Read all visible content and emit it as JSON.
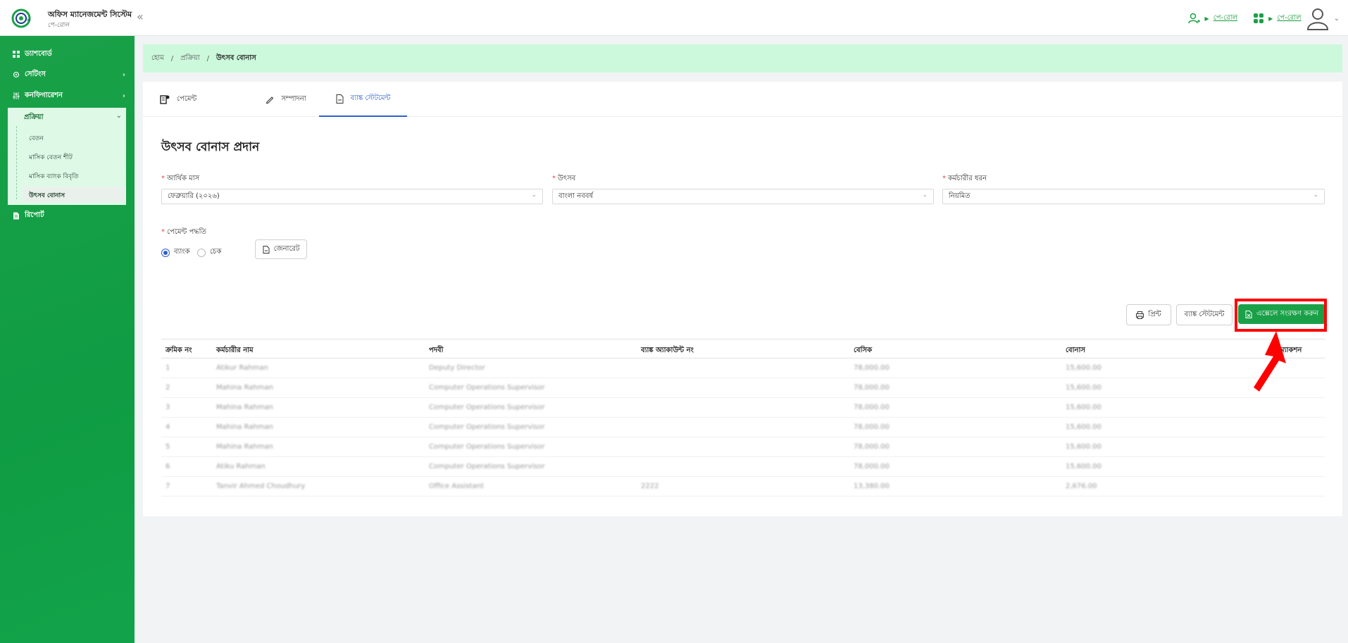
{
  "header": {
    "app_title": "অফিস ম্যানেজমেন্ট সিস্টেম",
    "app_subtitle": "পে-রোল",
    "collapse_icon": "double-chevron-left",
    "module_link_1": "পে-রোল",
    "module_link_2": "পে-রোল"
  },
  "sidebar": {
    "items": [
      {
        "label": "ড্যাশবোর্ড",
        "icon": "grid-icon"
      },
      {
        "label": "সেটিংস",
        "icon": "gear-icon"
      },
      {
        "label": "কনফিগারেশন",
        "icon": "sliders-icon"
      },
      {
        "label": "প্রক্রিয়া",
        "icon": "process-icon"
      },
      {
        "label": "রিপোর্ট",
        "icon": "document-icon"
      }
    ],
    "submenu": [
      {
        "label": "বেতন"
      },
      {
        "label": "মাসিক বেতন শীট"
      },
      {
        "label": "মাসিক ব্যাংক বিবৃতি"
      },
      {
        "label": "উৎসব বোনাস"
      }
    ]
  },
  "breadcrumb": {
    "home": "হোম",
    "sep": "/",
    "section": "প্রক্রিয়া",
    "current": "উৎসব বোনাস"
  },
  "tabs": [
    {
      "label": "পেমেন্ট",
      "active": false
    },
    {
      "label": "সম্পাদনা",
      "active": false
    },
    {
      "label": "ব্যাঙ্ক স্টেটমেন্ট",
      "active": true
    }
  ],
  "page_title": "উৎসব বোনাস প্রদান",
  "form": {
    "month_label": "আর্থিক মাস",
    "month_value": "ফেব্রুয়ারি (২০২৬)",
    "festival_label": "উৎসব",
    "festival_value": "বাংলা নববর্ষ",
    "emp_type_label": "কর্মচারীর ধরন",
    "emp_type_value": "নিয়মিত",
    "payment_label": "পেমেন্ট পদ্ধতি",
    "payment_options": [
      "ব্যাংক",
      "চেক"
    ],
    "payment_selected": "ব্যাংক",
    "generate_label": "জেনারেট"
  },
  "actions": {
    "print_label": "প্রিন্ট",
    "bank_statement_label": "ব্যাঙ্ক স্টেটমেন্ট",
    "save_excel_label": "এক্সেলে সংরক্ষণ করুন",
    "accent": "#1aa148",
    "highlight": "#ff0000"
  },
  "table": {
    "columns": [
      "ক্রমিক নং",
      "কর্মচারীর নাম",
      "পদবী",
      "ব্যাঙ্ক অ্যাকাউন্ট নং",
      "বেসিক",
      "বোনাস",
      "অ্যাকশন"
    ],
    "rows": [
      [
        "1",
        "Atikur Rahman",
        "Deputy Director",
        "",
        "78,000.00",
        "15,600.00"
      ],
      [
        "2",
        "Mahina Rahman",
        "Computer Operations Supervisor",
        "",
        "78,000.00",
        "15,600.00"
      ],
      [
        "3",
        "Mahina Rahman",
        "Computer Operations Supervisor",
        "",
        "78,000.00",
        "15,600.00"
      ],
      [
        "4",
        "Mahina Rahman",
        "Computer Operations Supervisor",
        "",
        "78,000.00",
        "15,600.00"
      ],
      [
        "5",
        "Mahina Rahman",
        "Computer Operations Supervisor",
        "",
        "78,000.00",
        "15,600.00"
      ],
      [
        "6",
        "Atiku Rahman",
        "Computer Operations Supervisor",
        "",
        "78,000.00",
        "15,600.00"
      ],
      [
        "7",
        "Tanvir Ahmed Choudhury",
        "Office Assistant",
        "2222",
        "13,380.00",
        "2,676.00"
      ]
    ]
  }
}
